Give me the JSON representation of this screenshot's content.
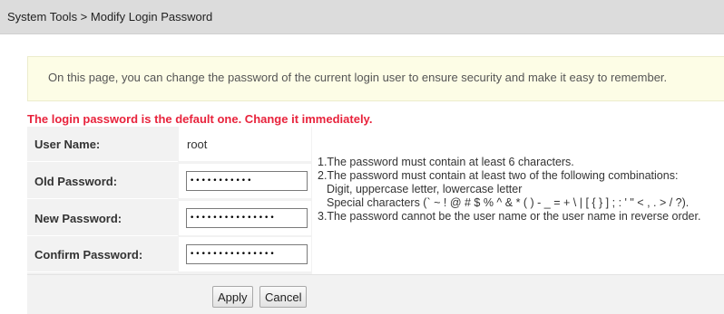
{
  "breadcrumb": "System Tools > Modify Login Password",
  "info": "On this page, you can change the password of the current login user to ensure security and make it easy to remember.",
  "warning": "The login password is the default one. Change it immediately.",
  "form": {
    "user_name_label": "User Name:",
    "user_name_value": "root",
    "old_password_label": "Old Password:",
    "old_password_value": "•••••••••••",
    "new_password_label": "New Password:",
    "new_password_value": "•••••••••••••••",
    "confirm_password_label": "Confirm Password:",
    "confirm_password_value": "•••••••••••••••"
  },
  "rules": [
    "1.The password must contain at least 6 characters.",
    "2.The password must contain at least two of the following combinations:",
    "Digit, uppercase letter, lowercase letter",
    "Special characters (` ~ ! @ # $ % ^ & * ( ) - _ = + \\ | [ { } ] ; : ' \" < , . > / ?).",
    "3.The password cannot be the user name or the user name in reverse order."
  ],
  "buttons": {
    "apply": "Apply",
    "cancel": "Cancel"
  },
  "colors": {
    "warning": "#e8233c",
    "info_background": "#fdfde6",
    "titlebar": "#dcdcdc"
  }
}
